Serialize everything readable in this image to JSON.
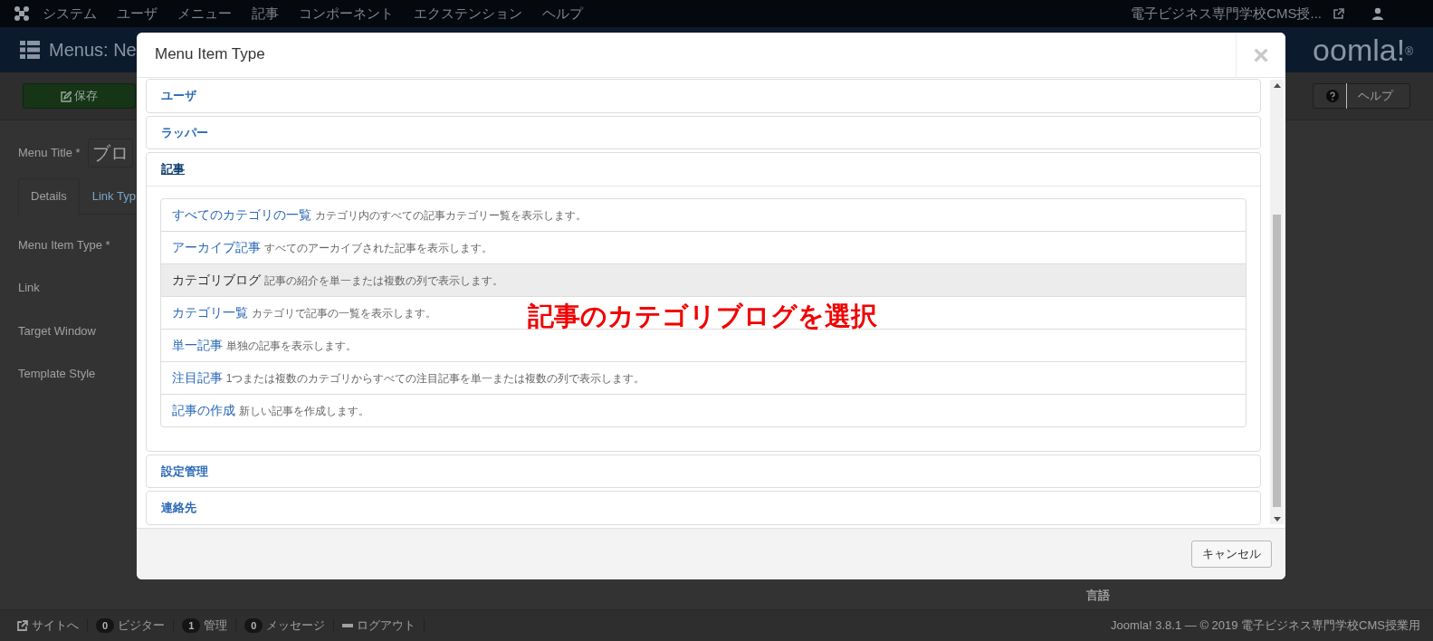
{
  "topbar": {
    "menus": [
      "システム",
      "ユーザ",
      "メニュー",
      "記事",
      "コンポーネント",
      "エクステンション",
      "ヘルプ"
    ],
    "site_link": "電子ビジネス専門学校CMS授..."
  },
  "header": {
    "title": "Menus: Ne",
    "logo": "oomla!$^{®}$"
  },
  "toolbar": {
    "save": "保存",
    "help": "ヘルプ"
  },
  "form": {
    "menu_title_label": "Menu Title *",
    "menu_title_value": "ブロ",
    "tabs": [
      {
        "label": "Details",
        "selected": true
      },
      {
        "label": "Link Typ",
        "selected": false
      }
    ],
    "fields": [
      "Menu Item Type *",
      "Link",
      "Target Window",
      "Template Style"
    ],
    "language_label": "言語"
  },
  "modal": {
    "title": "Menu Item Type",
    "close": "×",
    "groups": [
      {
        "label": "ユーザ",
        "expanded": false
      },
      {
        "label": "ラッパー",
        "expanded": false
      },
      {
        "label": "記事",
        "expanded": true,
        "items": [
          {
            "title": "すべてのカテゴリの一覧",
            "description": "カテゴリ内のすべての記事カテゴリー覧を表示します。",
            "selected": false
          },
          {
            "title": "アーカイブ記事",
            "description": "すべてのアーカイブされた記事を表示します。",
            "selected": false
          },
          {
            "title": "カテゴリブログ",
            "description": "記事の紹介を単一または複数の列で表示します。",
            "selected": true
          },
          {
            "title": "カテゴリ一覧",
            "description": "カテゴリで記事の一覧を表示します。",
            "selected": false
          },
          {
            "title": "単一記事",
            "description": "単独の記事を表示します。",
            "selected": false
          },
          {
            "title": "注目記事",
            "description": "1つまたは複数のカテゴリからすべての注目記事を単一または複数の列で表示します。",
            "selected": false
          },
          {
            "title": "記事の作成",
            "description": "新しい記事を作成します。",
            "selected": false
          }
        ]
      },
      {
        "label": "設定管理",
        "expanded": false
      },
      {
        "label": "連絡先",
        "expanded": false
      }
    ],
    "cancel": "キャンセル"
  },
  "annotation": "記事のカテゴリブログを選択",
  "status_bar": {
    "items": [
      {
        "kind": "link",
        "label": "サイトへ"
      },
      {
        "kind": "count",
        "count": "0",
        "label": "ビジター"
      },
      {
        "kind": "count",
        "count": "1",
        "label": "管理"
      },
      {
        "kind": "count",
        "count": "0",
        "label": "メッセージ"
      },
      {
        "kind": "logout",
        "label": "ログアウト"
      }
    ],
    "copyright": "Joomla! 3.8.1 — © 2019 電子ビジネス専門学校CMS授業用"
  }
}
